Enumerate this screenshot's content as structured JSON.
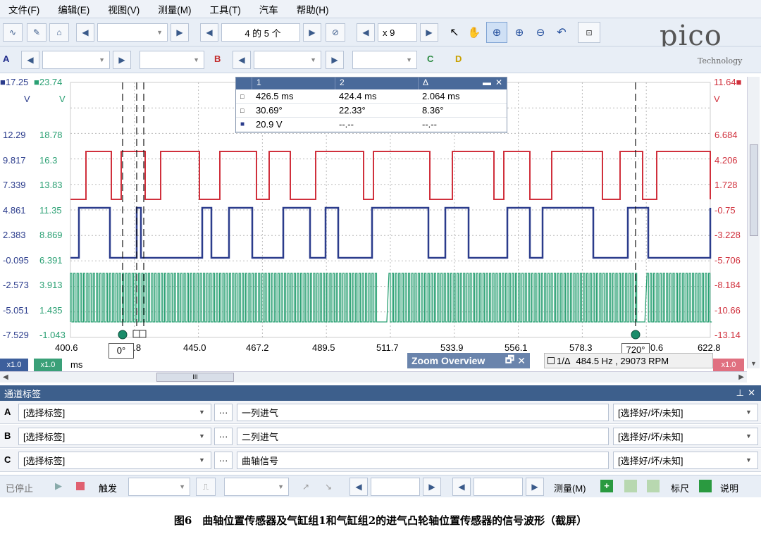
{
  "menu": [
    "文件(F)",
    "编辑(E)",
    "视图(V)",
    "测量(M)",
    "工具(T)",
    "汽车",
    "帮助(H)"
  ],
  "toolbar": {
    "page": "4 的 5 个",
    "zoom": "x 9",
    "brand": "pico",
    "brand_sub": "Technology"
  },
  "channels_toolbar": {
    "a": "A",
    "b": "B",
    "c": "C",
    "d": "D"
  },
  "plot": {
    "left_axis1_head": "17.25",
    "left_axis2_head": "23.74",
    "right_axis_head": "11.64",
    "unit_left1": "V",
    "unit_left2": "V",
    "unit_right": "V",
    "left_axis1": [
      "12.29",
      "9.817",
      "7.339",
      "4.861",
      "2.383",
      "-0.095",
      "-2.573",
      "-5.051",
      "-7.529"
    ],
    "left_axis2": [
      "18.78",
      "16.3",
      "13.83",
      "11.35",
      "8.869",
      "6.391",
      "3.913",
      "1.435",
      "-1.043"
    ],
    "right_axis": [
      "6.684",
      "4.206",
      "1.728",
      "-0.75",
      "-3.228",
      "-5.706",
      "-8.184",
      "-10.66",
      "-13.14"
    ],
    "x_ticks": [
      "400.6",
      "2.8",
      "445.0",
      "467.2",
      "489.5",
      "511.7",
      "533.9",
      "556.1",
      "578.3",
      "0.6",
      "622.8"
    ],
    "x_unit": "ms",
    "marker1": "0°",
    "marker2": "720°",
    "scale_left1": "x1.0",
    "scale_left2": "x1.0",
    "scale_right": "x1.0",
    "zoom_overview": "Zoom Overview",
    "freq_label": "1/Δ",
    "freq_value": "484.5 Hz , 29073 RPM",
    "colors": {
      "red": "#d0303c",
      "blue": "#2b3c8c",
      "green": "#2aa073"
    }
  },
  "measure_table": {
    "headers": [
      "1",
      "2",
      "Δ"
    ],
    "rows": [
      [
        "426.5 ms",
        "424.4 ms",
        "2.064 ms"
      ],
      [
        "30.69°",
        "22.33°",
        "8.36°"
      ],
      [
        "20.9 V",
        "--.--",
        "--.--"
      ]
    ]
  },
  "channel_panel": {
    "title": "通道标签",
    "rows": [
      {
        "ch": "A",
        "label": "[选择标签]",
        "desc": "一列进气",
        "status": "[选择好/坏/未知]"
      },
      {
        "ch": "B",
        "label": "[选择标签]",
        "desc": "二列进气",
        "status": "[选择好/坏/未知]"
      },
      {
        "ch": "C",
        "label": "[选择标签]",
        "desc": "曲轴信号",
        "status": "[选择好/坏/未知]"
      }
    ],
    "more": "···"
  },
  "status": {
    "stopped": "已停止",
    "trigger": "触发",
    "measure": "测量(M)",
    "ruler": "标尺",
    "notes": "说明"
  },
  "caption": "图6　曲轴位置传感器及气缸组1和气缸组2的进气凸轮轴位置传感器的信号波形（截屏）"
}
